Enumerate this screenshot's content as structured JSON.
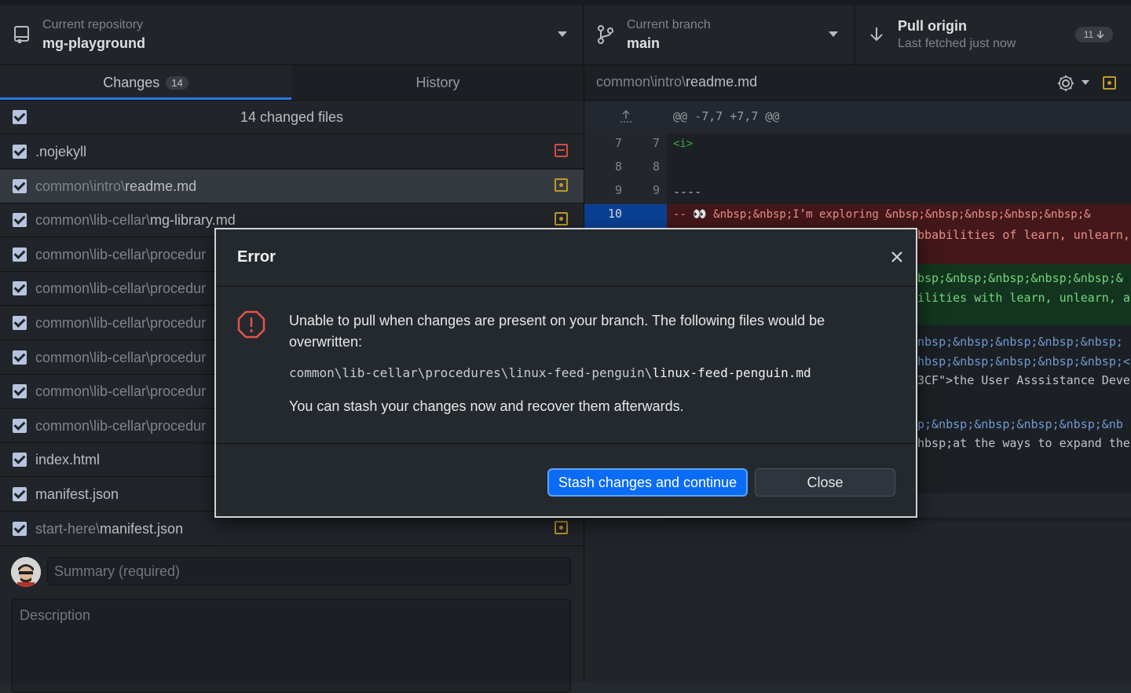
{
  "toolbar": {
    "repo_label": "Current repository",
    "repo_name": "mg-playground",
    "branch_label": "Current branch",
    "branch_name": "main",
    "pull_title": "Pull origin",
    "pull_sub": "Last fetched just now",
    "pull_count": "11"
  },
  "tabs": {
    "changes": "Changes",
    "changes_count": "14",
    "history": "History"
  },
  "changes": {
    "header": "14 changed files",
    "files": [
      {
        "dir": "",
        "name": ".nojekyll",
        "status": "deleted"
      },
      {
        "dir": "common\\intro\\",
        "name": "readme.md",
        "status": "modified"
      },
      {
        "dir": "common\\lib-cellar\\",
        "name": "mg-library.md",
        "status": "modified"
      },
      {
        "dir": "common\\lib-cellar\\procedur",
        "name": "",
        "status": "modified"
      },
      {
        "dir": "common\\lib-cellar\\procedur",
        "name": "",
        "status": "modified"
      },
      {
        "dir": "common\\lib-cellar\\procedur",
        "name": "",
        "status": "modified"
      },
      {
        "dir": "common\\lib-cellar\\procedur",
        "name": "",
        "status": "modified"
      },
      {
        "dir": "common\\lib-cellar\\procedur",
        "name": "",
        "status": "modified"
      },
      {
        "dir": "common\\lib-cellar\\procedur",
        "name": "",
        "status": "modified"
      },
      {
        "dir": "",
        "name": "index.html",
        "status": "modified"
      },
      {
        "dir": "",
        "name": "manifest.json",
        "status": "modified"
      },
      {
        "dir": "start-here\\",
        "name": "manifest.json",
        "status": "modified"
      }
    ]
  },
  "commit": {
    "summary_placeholder": "Summary (required)",
    "description_placeholder": "Description"
  },
  "diff": {
    "path_dir": "common\\intro\\",
    "path_file": "readme.md",
    "hunk": "@@ -7,7 +7,7 @@",
    "lines": [
      {
        "old": "7",
        "new": "7",
        "text": "<i>"
      },
      {
        "old": "8",
        "new": "8",
        "text": ""
      },
      {
        "old": "9",
        "new": "9",
        "text": "----"
      },
      {
        "old": "10",
        "new": "",
        "text": "-- 👀 &nbsp;&nbsp;I’m exploring &nbsp;&nbsp;&nbsp;&nbsp;&nbsp;&"
      }
    ],
    "right_fragments": [
      "bbabilities of learn, unlearn,",
      "bsp;&nbsp;&nbsp;&nbsp;&nbsp;&",
      "ilities with learn, unlearn, a",
      "nbsp;&nbsp;&nbsp;&nbsp;&nbsp;",
      "hbsp;&nbsp;&nbsp;&nbsp;&nbsp;<",
      "3CF\">the User Asssistance Deve",
      "p;&nbsp;&nbsp;&nbsp;&nbsp;&nb",
      "hbsp;at the ways to expand the"
    ]
  },
  "dialog": {
    "title": "Error",
    "message": "Unable to pull when changes are present on your branch. The following files would be overwritten:",
    "path_dir": "common\\lib-cellar\\procedures\\linux-feed-penguin\\",
    "path_file": "linux-feed-penguin.md",
    "hint": "You can stash your changes now and recover them afterwards.",
    "primary_button": "Stash changes and continue",
    "secondary_button": "Close"
  },
  "colors": {
    "accent": "#0a6cf5",
    "modified": "#d1a52b",
    "deleted": "#e5534b",
    "error": "#e5534b"
  }
}
